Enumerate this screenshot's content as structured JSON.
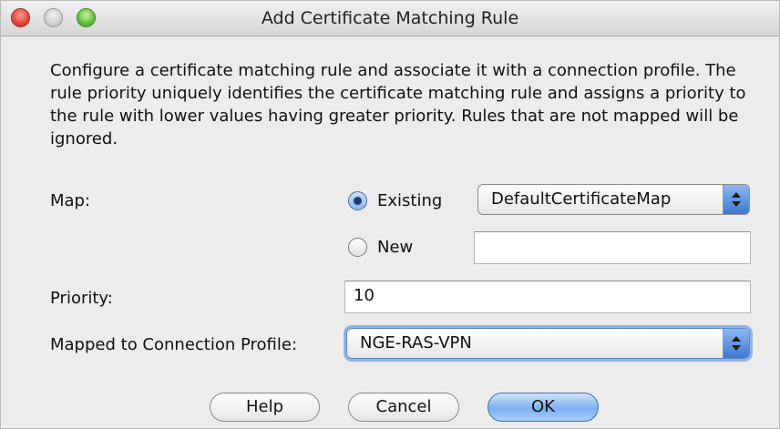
{
  "window": {
    "title": "Add Certificate Matching Rule"
  },
  "description": "Configure a certificate matching rule and associate it with a connection profile. The rule priority uniquely identifies the certificate matching rule and assigns a priority to the rule with lower values having greater priority. Rules that are not mapped will be ignored.",
  "map": {
    "label": "Map:",
    "existing_label": "Existing",
    "existing_checked": true,
    "existing_value": "DefaultCertificateMap",
    "new_label": "New",
    "new_checked": false,
    "new_value": ""
  },
  "priority": {
    "label": "Priority:",
    "value": "10"
  },
  "connection_profile": {
    "label": "Mapped to Connection Profile:",
    "value": "NGE-RAS-VPN"
  },
  "buttons": {
    "help": "Help",
    "cancel": "Cancel",
    "ok": "OK"
  },
  "colors": {
    "close": "#e0453a",
    "maximize": "#5fbf3b",
    "accent": "#3d78d0"
  }
}
